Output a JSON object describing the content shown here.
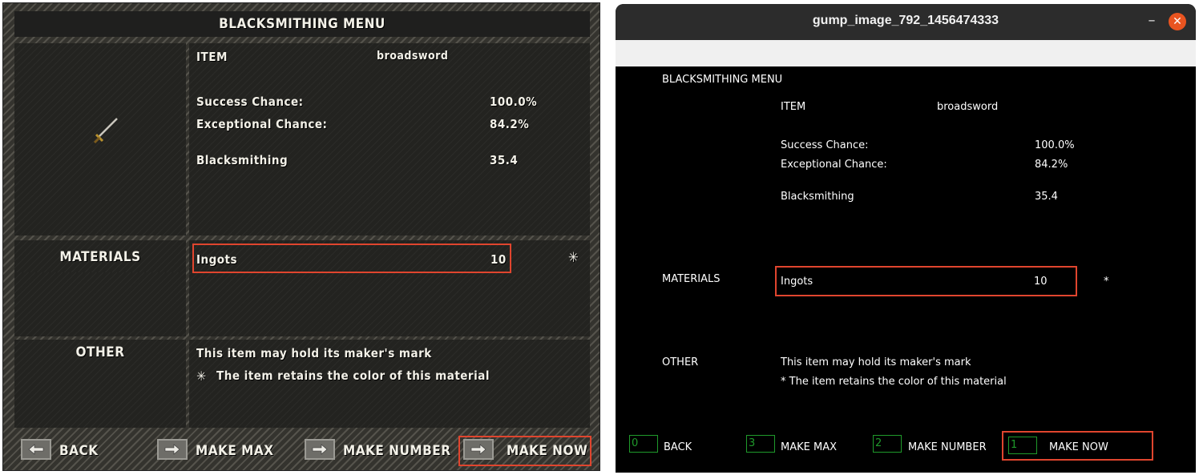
{
  "gump": {
    "title": "BLACKSMITHING MENU",
    "item_label": "ITEM",
    "item_name": "broadsword",
    "item_icon": "sword-icon",
    "success_label": "Success Chance:",
    "success_value": "100.0%",
    "exceptional_label": "Exceptional Chance:",
    "exceptional_value": "84.2%",
    "skill_label": "Blacksmithing",
    "skill_value": "35.4",
    "materials_label": "MATERIALS",
    "material_name": "Ingots",
    "material_qty": "10",
    "material_marker": "✳",
    "other_label": "OTHER",
    "other_line1": "This item may hold its maker's mark",
    "other_line2_marker": "✳",
    "other_line2": "The item retains the color of this material",
    "buttons": {
      "back": "BACK",
      "make_max": "MAKE MAX",
      "make_number": "MAKE NUMBER",
      "make_now": "MAKE NOW"
    }
  },
  "window": {
    "title": "gump_image_792_1456474333",
    "minimize_glyph": "–",
    "close_glyph": "✕",
    "content": {
      "title": "BLACKSMITHING MENU",
      "item_label": "ITEM",
      "item_name": "broadsword",
      "success_label": "Success Chance:",
      "success_value": "100.0%",
      "exceptional_label": "Exceptional Chance:",
      "exceptional_value": "84.2%",
      "skill_label": "Blacksmithing",
      "skill_value": "35.4",
      "materials_label": "MATERIALS",
      "material_name": "Ingots",
      "material_qty": "10",
      "material_marker": "*",
      "other_label": "OTHER",
      "other_line1": "This item may hold its maker's mark",
      "other_line2": "* The item retains the color of this material",
      "buttons": [
        {
          "id": "0",
          "label": "BACK"
        },
        {
          "id": "3",
          "label": "MAKE MAX"
        },
        {
          "id": "2",
          "label": "MAKE NUMBER"
        },
        {
          "id": "1",
          "label": "MAKE NOW"
        }
      ]
    }
  },
  "colors": {
    "highlight": "#e0452e",
    "button_id": "#1f9a2b",
    "close_button": "#e95420"
  }
}
